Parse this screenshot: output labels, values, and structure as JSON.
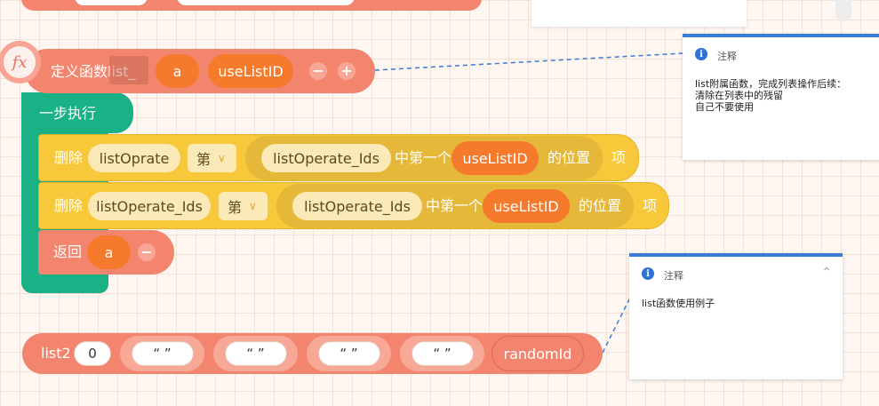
{
  "define_block": {
    "icon_glyph": "fx",
    "label": "定义函数list_",
    "param_a": "a",
    "param_use": "useListID",
    "minus": "−",
    "plus": "+"
  },
  "seq_block": {
    "label": "一步执行"
  },
  "row1": {
    "op": "删除",
    "list_name": "listOprate",
    "ordinal": "第",
    "inner_list": "listOperate_Ids",
    "first_of": "中第一个",
    "value": "useListID",
    "position": "的位置",
    "item": "项"
  },
  "row2": {
    "op": "删除",
    "list_name": "listOperate_Ids",
    "ordinal": "第",
    "inner_list": "listOperate_Ids",
    "first_of": "中第一个",
    "value": "useListID",
    "position": "的位置",
    "item": "项"
  },
  "return_block": {
    "label": "返回",
    "value": "a",
    "minus": "−"
  },
  "list2_block": {
    "label": "list2",
    "num": "0",
    "str1": "“ ”",
    "str2": "“ ”",
    "str3": "“ ”",
    "str4": "“ ”",
    "last": "randomId"
  },
  "note1": {
    "title": "注释",
    "body": "list附属函数，完成列表操作后续：\n清除在列表中的残留\n自己不要使用"
  },
  "note2": {
    "title": "注释",
    "body": "list函数使用例子",
    "collapse_glyph": "⌃"
  },
  "colors": {
    "block_salmon": "#f3846d",
    "control_teal": "#1bb187",
    "list_yellow": "#f7c93a",
    "note_accent": "#3a7bd5"
  }
}
